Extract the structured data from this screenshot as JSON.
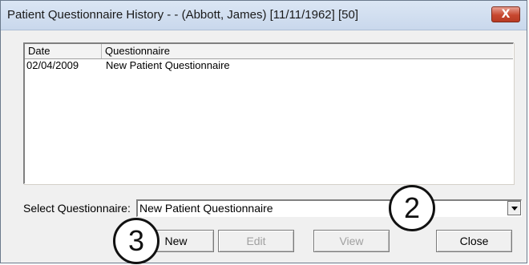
{
  "window": {
    "title": "Patient Questionnaire History -  - (Abbott, James) [11/11/1962] [50]",
    "close_glyph": "X"
  },
  "list": {
    "columns": [
      "Date",
      "Questionnaire"
    ],
    "rows": [
      {
        "date": "02/04/2009",
        "questionnaire": "New Patient Questionnaire"
      }
    ]
  },
  "select": {
    "label": "Select Questionnaire:",
    "value": "New Patient Questionnaire"
  },
  "buttons": {
    "new": "New",
    "edit": "Edit",
    "view": "View",
    "close": "Close"
  },
  "callouts": {
    "two": "2",
    "three": "3"
  },
  "colors": {
    "title_bar": "#c9d8ec",
    "close_button": "#c7472f",
    "disabled_text": "#a0a0a0"
  }
}
